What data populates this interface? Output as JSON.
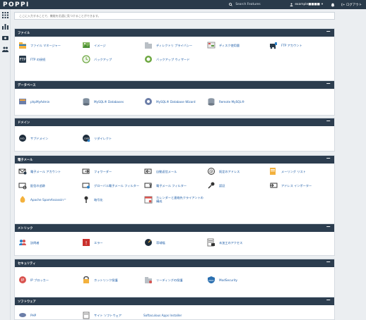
{
  "brand": "POPPI",
  "header": {
    "search_placeholder": "Search Features",
    "user": "example■■■■",
    "logout": "ログアウト"
  },
  "search": {
    "placeholder": "ここに入力することで、機能を迅速に見つけることができます。"
  },
  "sections": {
    "files": {
      "title": "ファイル",
      "items": [
        {
          "label": "ファイル マネージャー",
          "icon": "file-manager-icon"
        },
        {
          "label": "イメージ",
          "icon": "images-icon"
        },
        {
          "label": "ディレクトリ プライバシー",
          "icon": "directory-privacy-icon"
        },
        {
          "label": "ディスク使用量",
          "icon": "disk-usage-icon"
        },
        {
          "label": "FTP アカウント",
          "icon": "ftp-accounts-icon"
        },
        {
          "label": "FTP の接続",
          "icon": "ftp-connections-icon"
        },
        {
          "label": "バックアップ",
          "icon": "backup-icon"
        },
        {
          "label": "バックアップ ウィザード",
          "icon": "backup-wizard-icon"
        }
      ]
    },
    "databases": {
      "title": "データベース",
      "items": [
        {
          "label": "phpMyAdmin",
          "icon": "phpmyadmin-icon"
        },
        {
          "label": "MySQL® Databases",
          "icon": "mysql-databases-icon"
        },
        {
          "label": "MySQL® Database Wizard",
          "icon": "mysql-wizard-icon"
        },
        {
          "label": "Remote MySQL®",
          "icon": "remote-mysql-icon"
        }
      ]
    },
    "domains": {
      "title": "ドメイン",
      "items": [
        {
          "label": "サブドメイン",
          "icon": "subdomains-icon"
        },
        {
          "label": "リダイレクト",
          "icon": "redirects-icon"
        }
      ]
    },
    "email": {
      "title": "電子メール",
      "items": [
        {
          "label": "電子メール アカウント",
          "icon": "email-accounts-icon"
        },
        {
          "label": "フォワーダー",
          "icon": "forwarders-icon"
        },
        {
          "label": "自動返信メール",
          "icon": "autoresponders-icon"
        },
        {
          "label": "既定のアドレス",
          "icon": "default-address-icon"
        },
        {
          "label": "メーリング リスト",
          "icon": "mailing-lists-icon"
        },
        {
          "label": "配信の追跡",
          "icon": "track-delivery-icon"
        },
        {
          "label": "グローバル電子メール フィルター",
          "icon": "global-email-filters-icon"
        },
        {
          "label": "電子メール フィルター",
          "icon": "email-filters-icon"
        },
        {
          "label": "認証",
          "icon": "authentication-icon"
        },
        {
          "label": "アドレス インポーター",
          "icon": "address-importer-icon"
        },
        {
          "label": "Apache SpamAssassin™",
          "icon": "spamassassin-icon"
        },
        {
          "label": "暗号化",
          "icon": "encryption-icon"
        },
        {
          "label": "カレンダーと連絡先クライアントの構成",
          "icon": "calendar-contacts-icon"
        }
      ]
    },
    "metrics": {
      "title": "メトリック",
      "items": [
        {
          "label": "訪問者",
          "icon": "visitors-icon"
        },
        {
          "label": "エラー",
          "icon": "errors-icon"
        },
        {
          "label": "帯域幅",
          "icon": "bandwidth-icon"
        },
        {
          "label": "未加工のアクセス",
          "icon": "raw-access-icon"
        }
      ]
    },
    "security": {
      "title": "セキュリティ",
      "items": [
        {
          "label": "IP ブロッカー",
          "icon": "ip-blocker-icon"
        },
        {
          "label": "ホットリンク保護",
          "icon": "hotlink-protection-icon"
        },
        {
          "label": "リーディングの保護",
          "icon": "leech-protection-icon"
        },
        {
          "label": "ModSecurity",
          "icon": "modsecurity-icon"
        }
      ]
    },
    "software": {
      "title": "ソフトウェア",
      "items": [
        {
          "label": "PHP",
          "icon": "php-icon"
        },
        {
          "label": "サイト ソフトウェア",
          "icon": "site-software-icon"
        },
        {
          "label": "Softaculous Apps Installer",
          "icon": "softaculous-icon"
        }
      ]
    }
  },
  "colors": {
    "header": "#293a4a",
    "section_header": "#2c3d4f",
    "link": "#1f5ea8"
  }
}
